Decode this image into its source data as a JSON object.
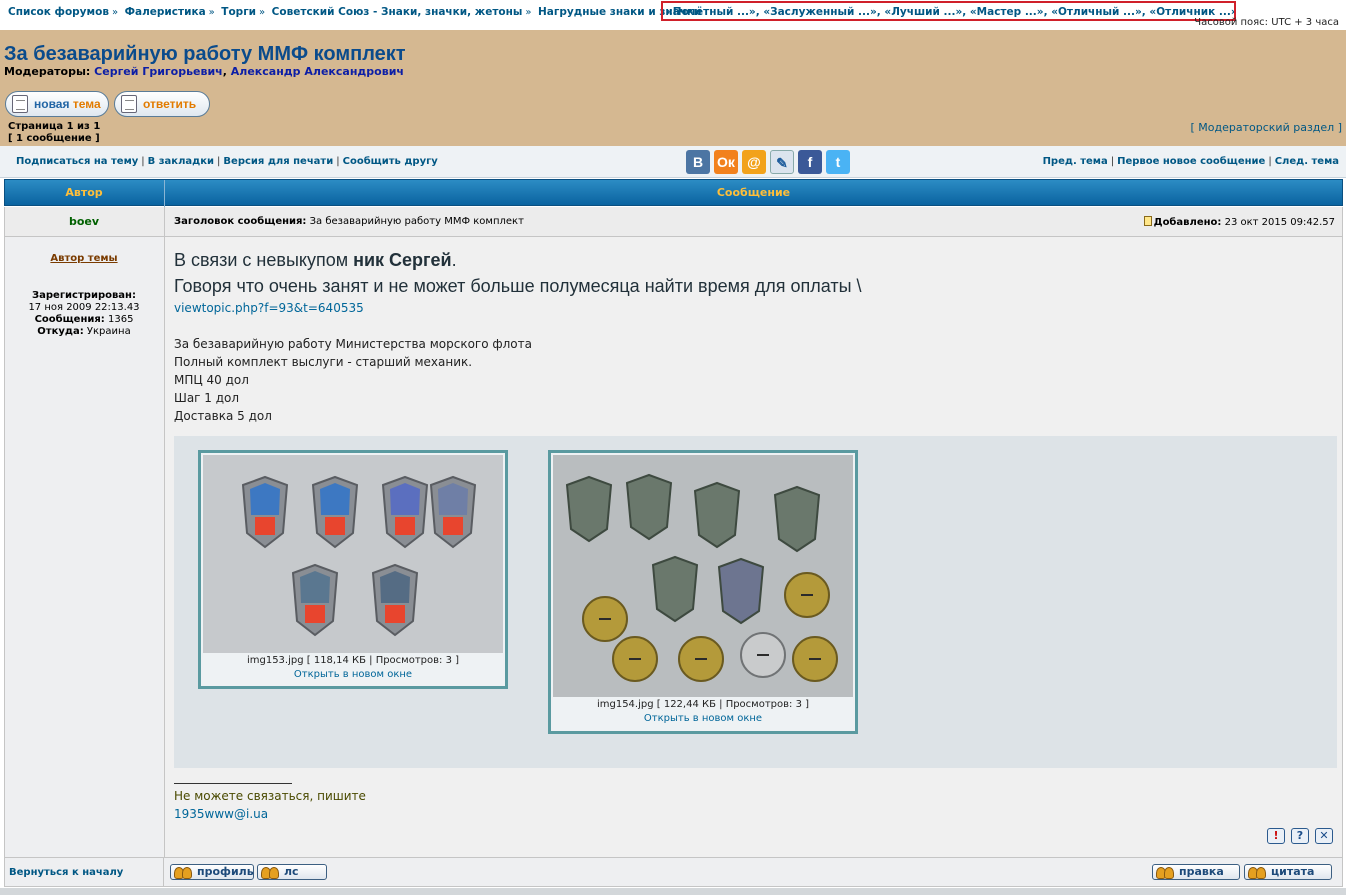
{
  "breadcrumb": {
    "items": [
      "Список форумов",
      "Фалеристика",
      "Торги",
      "Советский Союз - Знаки, значки, жетоны",
      "Нагрудные знаки и значки"
    ],
    "sep": "»",
    "subforums": "«Почётный ...», «Заслуженный ...», «Лучший ...», «Мастер ...», «Отличный ...», «Отличник ...»"
  },
  "timezone": "Часовой пояс: UTC + 3 часа",
  "header": {
    "title": "За безаварийную работу ММФ комплект",
    "moderators_label": "Модераторы:",
    "moderator1": "Сергей Григорьевич",
    "comma": ",",
    "moderator2": "Александр Александрович",
    "newtopic_w1": "новая",
    "newtopic_w2": "тема",
    "reply_label": "ответить",
    "page_line1": "Страница 1 из 1",
    "page_line2": "[ 1 сообщение ]",
    "mod_section": "[ Модераторский раздел ]"
  },
  "links": {
    "subscribe": "Подписаться на тему",
    "bookmarks": "В закладки",
    "print": "Версия для печати",
    "tell": "Сообщить другу",
    "prev": "Пред. тема",
    "firstnew": "Первое новое сообщение",
    "next": "След. тема",
    "pipe": "|"
  },
  "social": {
    "vk": "В",
    "ok": "Ок",
    "mail": "@",
    "lj": "✎",
    "fb": "f",
    "tw": "t"
  },
  "table": {
    "col_author": "Автор",
    "col_message": "Сообщение"
  },
  "post": {
    "author": "boev",
    "subject_label": "Заголовок сообщения:",
    "subject": "За безаварийную работу ММФ комплект",
    "added_label": "Добавлено:",
    "added": "23 окт 2015 09:42.57",
    "author_tag": "Автор темы",
    "registered_label": "Зарегистрирован:",
    "registered": "17 ноя 2009 22:13.43",
    "posts_label": "Сообщения:",
    "posts": "1365",
    "from_label": "Откуда:",
    "from": "Украина",
    "big1_a": "В связи с невыкупом ",
    "big1_b": "ник Сергей",
    "big1_c": ".",
    "big2": "Говоря что очень занят и не может больше полумесяца найти время для оплаты \\",
    "link": "viewtopic.php?f=93&t=640535",
    "line1": "За безаварийную работу Министерства морского флота",
    "line2": "Полный комплект выслуги - старший механик.",
    "line3": "МПЦ 40 дол",
    "line4": "Шаг 1 дол",
    "line5": "Доставка 5 дол",
    "att1_caption": "img153.jpg [ 118,14 КБ | Просмотров: 3 ]",
    "att2_caption": "img154.jpg [ 122,44 КБ | Просмотров: 3 ]",
    "open_new": "Открыть в новом окне",
    "sig1": "Не можете связаться, пишите",
    "sig2": "1935www@i.ua"
  },
  "icons": {
    "report": "!",
    "help": "?",
    "delete": "✕"
  },
  "footer": {
    "back_to_top": "Вернуться к началу",
    "profile": "профиль",
    "pm": "лс",
    "edit": "правка",
    "quote": "цитата"
  },
  "colors": {
    "header_bg": "#d5b891",
    "table_head": "#0a63a0",
    "table_head_text": "#ffbf3a",
    "link": "#005784",
    "title": "#0a4b8c"
  }
}
